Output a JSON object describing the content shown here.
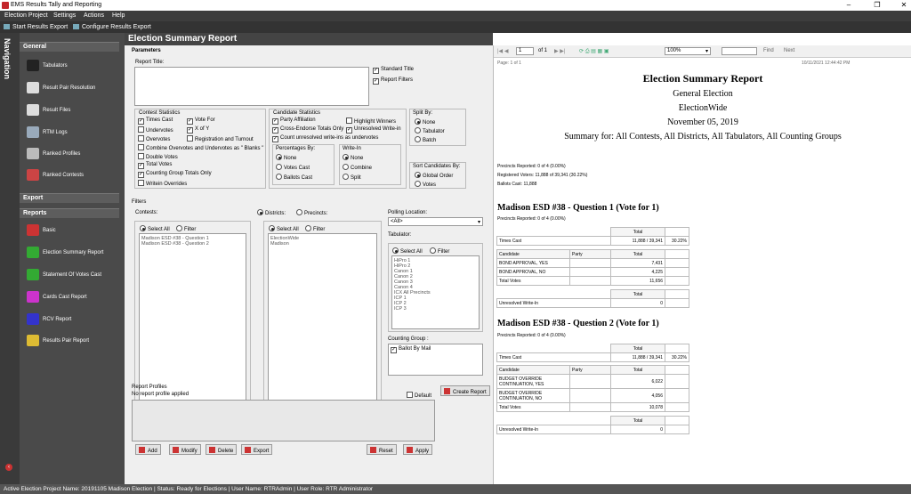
{
  "app": {
    "title": "EMS Results Tally and Reporting"
  },
  "menu": [
    "Election Project",
    "Settings",
    "Actions",
    "Help"
  ],
  "toolbar": {
    "start": "Start Results Export",
    "configure": "Configure Results Export"
  },
  "nav": {
    "label": "Navigation",
    "general": "General",
    "general_items": [
      "Tabulators",
      "Result Pair Resolution",
      "Result Files",
      "RTM Logs",
      "Ranked Profiles",
      "Ranked Contests"
    ],
    "export": "Export",
    "reports": "Reports",
    "report_items": [
      "Basic",
      "Election Summary Report",
      "Statement Of Votes Cast",
      "Cards Cast Report",
      "RCV Report",
      "Results Pair Report"
    ]
  },
  "header": "Election Summary Report",
  "params": {
    "title": "Parameters",
    "report_title": "Report Title:",
    "standard_title": "Standard Title",
    "report_filters": "Report Filters",
    "contest_stats": "Contest Statistics",
    "cs": [
      "Times Cast",
      "Vote For",
      "Undervotes",
      "X of Y",
      "Overvotes",
      "Registration and Turnout",
      "Combine Overvotes and Undervotes as \" Blanks \"",
      "Double Votes",
      "Total Votes",
      "Counting Group Totals Only",
      "Writein Overrides"
    ],
    "cand_stats": "Candidate Statistics",
    "cand": [
      "Party Affiliation",
      "Highlight Winners",
      "Cross-Endorse Totals Only",
      "Unresolved Write-in",
      "Count unresolved write-ins as undervotes"
    ],
    "pct_by": "Percentages By:",
    "pct": [
      "None",
      "Votes Cast",
      "Ballots Cast"
    ],
    "writein": "Write-In",
    "wi": [
      "None",
      "Combine",
      "Split"
    ],
    "split_by": "Split By:",
    "split": [
      "None",
      "Tabulator",
      "Batch"
    ],
    "sort_by": "Sort Candidates By:",
    "sort": [
      "Global Order",
      "Votes"
    ]
  },
  "filters": {
    "title": "Filters",
    "contests": "Contests:",
    "districts": "Districts:",
    "precincts": "Precincts:",
    "select_all": "Select All",
    "filter": "Filter",
    "contest_list": [
      "Madison ESD #38 - Question 1",
      "Madison ESD #38 - Question 2"
    ],
    "district_list": [
      "ElectionWide",
      "Madison"
    ],
    "polling": "Polling Location:",
    "polling_value": "<All>",
    "tabulator": "Tabulator:",
    "tab_list": [
      "HiPro 1",
      "HiPro 2",
      "Canon 1",
      "Canon 2",
      "Canon 3",
      "Canon 4",
      "ICX All Precincts",
      "ICP 1",
      "ICP 2",
      "ICP 3"
    ],
    "counting_group": "Counting Group :",
    "cg_item": "Ballot By Mail"
  },
  "profiles": {
    "title": "Report Profiles",
    "none": "No report profile applied",
    "default": "Default",
    "create": "Create Report"
  },
  "buttons": {
    "add": "Add",
    "modify": "Modify",
    "delete": "Delete",
    "export": "Export",
    "reset": "Reset",
    "apply": "Apply"
  },
  "viewer": {
    "page": "1",
    "of": "of 1",
    "zoom": "100%",
    "find": "Find",
    "next": "Next",
    "page_info": "Page: 1 of 1",
    "timestamp": "10/11/2021 12:44:42 PM"
  },
  "report": {
    "title": "Election Summary Report",
    "sub1": "General Election",
    "sub2": "ElectionWide",
    "date": "November 05, 2019",
    "summary": "Summary for: All Contests, All Districts, All Tabulators, All Counting Groups",
    "precincts": "Precincts Reported: 0 of 4 (0.00%)",
    "registered": "Registered Voters: 11,888 of 39,341 (30.22%)",
    "ballots": "Ballots Cast: 11,888",
    "q1": {
      "name": "Madison ESD #38 - Question 1 (Vote for  1)",
      "prec": "Precincts Reported: 0 of 4 (0.00%)",
      "times": "11,888 / 39,341",
      "pct": "30.22%",
      "cands": [
        [
          "BOND APPROVAL, YES",
          "7,431"
        ],
        [
          "BOND APPROVAL, NO",
          "4,225"
        ]
      ],
      "total": "11,656",
      "unres": "0"
    },
    "q2": {
      "name": "Madison ESD #38 - Question 2 (Vote for  1)",
      "prec": "Precincts Reported: 0 of 4 (0.00%)",
      "times": "11,888 / 39,341",
      "pct": "30.22%",
      "cands": [
        [
          "BUDGET OVERRIDE CONTINUATION, YES",
          "6,022"
        ],
        [
          "BUDGET OVERRIDE CONTINUATION, NO",
          "4,056"
        ]
      ],
      "total": "10,078",
      "unres": "0"
    },
    "lbl_total": "Total",
    "lbl_times": "Times Cast",
    "lbl_cand": "Candidate",
    "lbl_party": "Party",
    "lbl_tv": "Total Votes",
    "lbl_unres": "Unresolved Write-In"
  },
  "status": "Active Election Project Name: 20191105 Madison Election | Status: Ready for Elections | User Name: RTRAdmin | User Role: RTR Administrator"
}
